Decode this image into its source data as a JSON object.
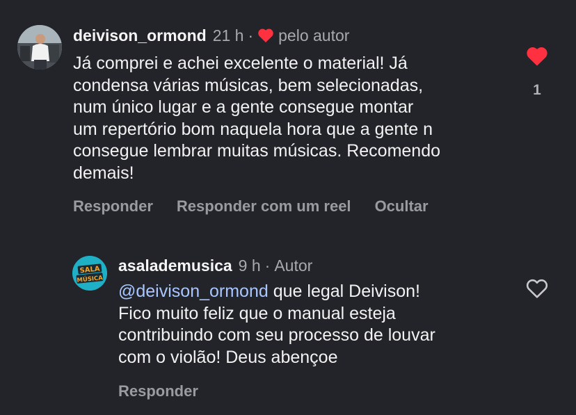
{
  "comments": [
    {
      "username": "deivison_ormond",
      "time": "21 h",
      "separator": "·",
      "liked_by_author_label": "pelo autor",
      "text_lines": [
        "Já comprei e achei excelente o material! Já",
        "condensa várias músicas, bem selecionadas,",
        "num único lugar e a gente consegue montar",
        "um repertório bom naquela hora que a gente n",
        "consegue lembrar muitas músicas. Recomendo",
        "demais!"
      ],
      "actions": [
        "Responder",
        "Responder com um reel",
        "Ocultar"
      ],
      "like_count": "1",
      "liked": true
    }
  ],
  "reply": {
    "username": "asalademusica",
    "time": "9 h",
    "separator": "·",
    "badge": "Autor",
    "mention": "@deivison_ormond",
    "first_line_rest": " que legal Deivison!",
    "text_lines": [
      "Fico muito feliz que o manual esteja",
      "contribuindo com seu processo de louvar",
      "com o violão! Deus abençoe"
    ],
    "actions": [
      "Responder"
    ],
    "liked": false,
    "avatar_text_top": "SALA",
    "avatar_text_bottom": "MÚSICA"
  },
  "colors": {
    "background": "#23242a",
    "heart_red": "#ff3040",
    "mention_blue": "#a8c6ff",
    "avatar_teal": "#1fb0c6",
    "avatar_orange": "#f5a623"
  }
}
